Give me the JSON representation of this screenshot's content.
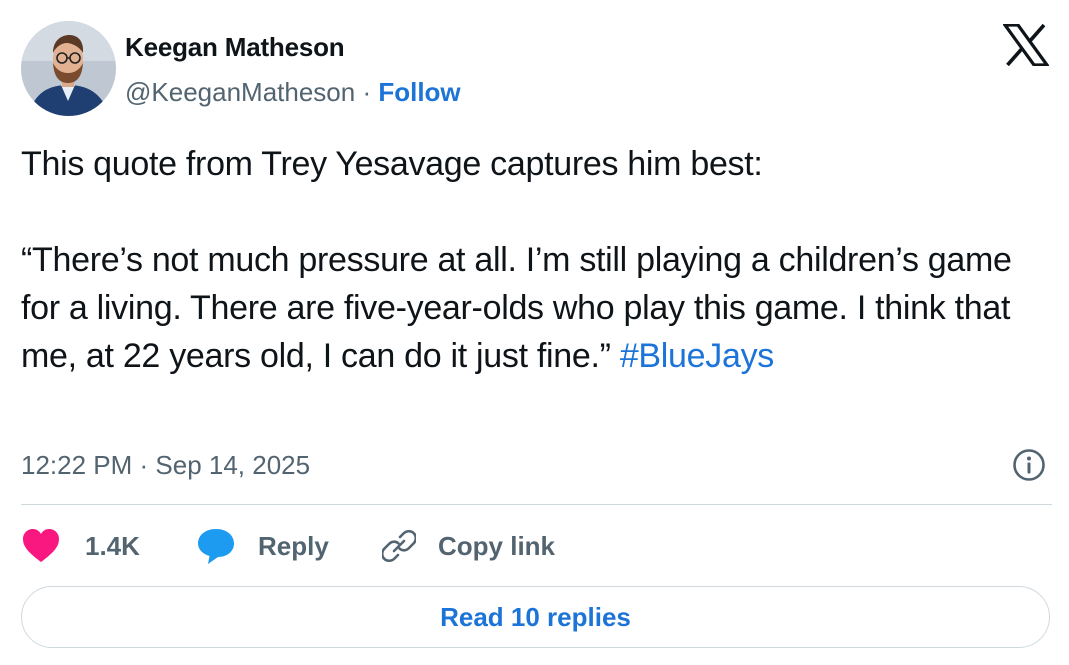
{
  "author": {
    "name": "Keegan Matheson",
    "handle": "@KeeganMatheson",
    "separator": " · ",
    "follow_label": "Follow"
  },
  "tweet": {
    "text": "This quote from Trey Yesavage captures him best:\n\n“There’s not much pressure at all. I’m still playing a children’s game for a living. There are five-year-olds who play this game. I think that me, at 22 years old, I can do it just fine.” ",
    "hashtag": "#BlueJays",
    "time": "12:22 PM",
    "date_separator": " · ",
    "date": "Sep 14, 2025"
  },
  "actions": {
    "like_count": "1.4K",
    "reply_label": "Reply",
    "copy_link_label": "Copy link"
  },
  "read_replies_label": "Read 10 replies",
  "colors": {
    "link": "#1d74d8",
    "heart": "#f91880",
    "reply_bubble": "#1d9bf0",
    "muted": "#536471"
  }
}
